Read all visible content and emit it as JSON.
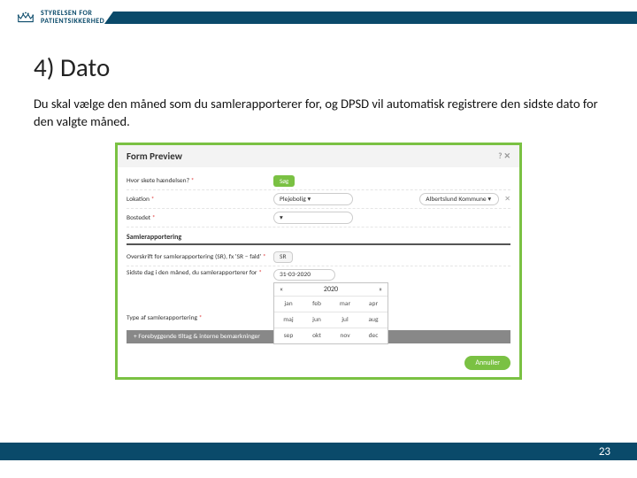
{
  "header": {
    "logo_line1": "STYRELSEN FOR",
    "logo_line2": "PATIENTSIKKERHED"
  },
  "title": "4) Dato",
  "description": "Du skal vælge den måned som du samlerapporterer for, og DPSD vil automatisk registrere den sidste dato for den valgte måned.",
  "screenshot": {
    "title": "Form Preview",
    "title_icons": "? ✕",
    "q1_label": "Hvor skete hændelsen?",
    "q1_btn": "Søg",
    "lokation_label": "Lokation",
    "lokation_value": "Plejebolig",
    "lokation_value2": "Albertslund Kommune",
    "bosted_label": "Bostedet",
    "section": "Samlerapportering",
    "q2_label": "Overskrift for samlerapportering (SR), fx 'SR – fald'",
    "q2_value": "SR",
    "q3_label": "Sidste dag i den måned, du samlerapporterer for",
    "q3_value": "31-03-2020",
    "q4_label": "Type af samlerapportering",
    "cal_year": "2020",
    "cal_prev": "«",
    "cal_next": "»",
    "months": [
      "jan",
      "feb",
      "mar",
      "apr",
      "maj",
      "jun",
      "jul",
      "aug",
      "sep",
      "okt",
      "nov",
      "dec"
    ],
    "accordion": "+ Forebyggende tiltag & interne bemærkninger",
    "annuller": "Annuller",
    "caret": "▾",
    "x": "✕"
  },
  "page_number": "23"
}
